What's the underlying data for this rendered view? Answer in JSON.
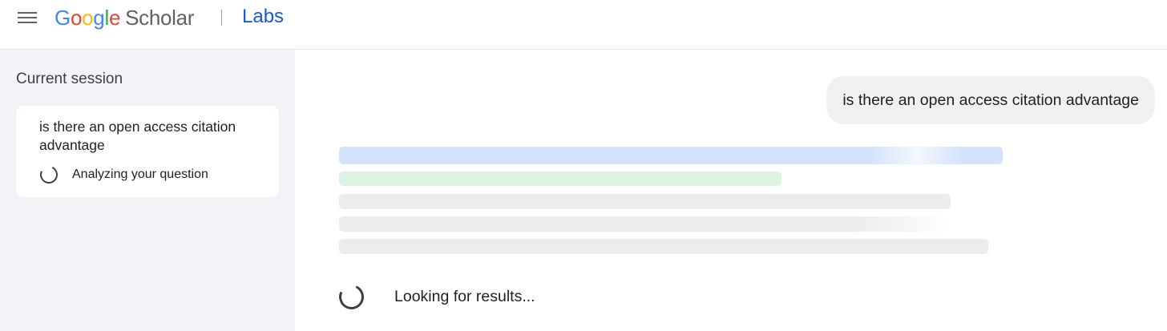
{
  "header": {
    "menu_icon": "hamburger-menu-icon",
    "logo": {
      "letters": [
        {
          "char": "G",
          "color": "#4285f4"
        },
        {
          "char": "o",
          "color": "#ea4335"
        },
        {
          "char": "o",
          "color": "#fbbc05"
        },
        {
          "char": "g",
          "color": "#4285f4"
        },
        {
          "char": "l",
          "color": "#34a853"
        },
        {
          "char": "e",
          "color": "#ea4335"
        }
      ],
      "product": "Scholar"
    },
    "labs": "Labs"
  },
  "sidebar": {
    "title": "Current session",
    "session": {
      "query": "is there an open access citation advantage",
      "status": "Analyzing your question",
      "status_icon": "spinner-icon"
    }
  },
  "main": {
    "user_message": "is there an open access citation advantage",
    "loading_text": "Looking for results...",
    "loading_icon": "spinner-icon"
  },
  "colors": {
    "sidebar_bg": "#f3f4f8",
    "labs_blue": "#1a56db",
    "skeleton_blue": "#d3e2fd",
    "skeleton_green": "#dcf3e4",
    "skeleton_gray": "#ececec",
    "bubble_bg": "#f1f1f1"
  }
}
